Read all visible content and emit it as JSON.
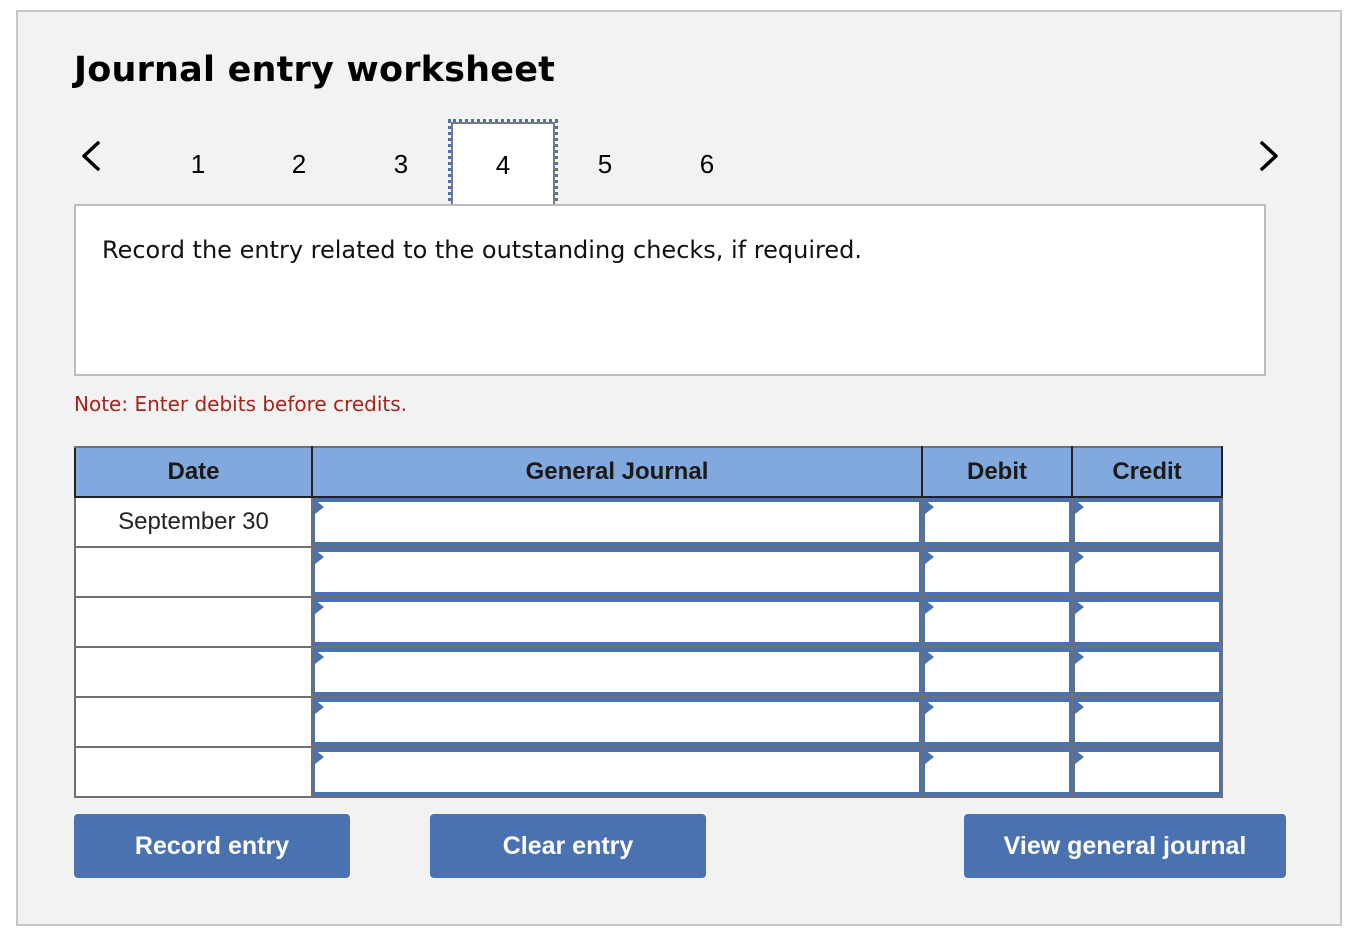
{
  "header": {
    "title": "Journal entry worksheet"
  },
  "stepper": {
    "prev_icon": "chevron-left-icon",
    "next_icon": "chevron-right-icon",
    "steps": [
      "1",
      "2",
      "3",
      "4",
      "5",
      "6"
    ],
    "active_step": "4"
  },
  "prompt": {
    "text": "Record the entry related to the outstanding checks, if required."
  },
  "note": {
    "text": "Note: Enter debits before credits.",
    "color": "#a6231c"
  },
  "journal_table": {
    "columns": [
      "Date",
      "General Journal",
      "Debit",
      "Credit"
    ],
    "rows": [
      {
        "date": "September 30",
        "account": "",
        "debit": "",
        "credit": ""
      },
      {
        "date": "",
        "account": "",
        "debit": "",
        "credit": ""
      },
      {
        "date": "",
        "account": "",
        "debit": "",
        "credit": ""
      },
      {
        "date": "",
        "account": "",
        "debit": "",
        "credit": ""
      },
      {
        "date": "",
        "account": "",
        "debit": "",
        "credit": ""
      },
      {
        "date": "",
        "account": "",
        "debit": "",
        "credit": ""
      }
    ],
    "header_color": "#81a9de",
    "input_border_color": "#4a72b0"
  },
  "buttons": {
    "record_entry": "Record entry",
    "clear_entry": "Clear entry",
    "view_general_journal": "View general journal",
    "color": "#4a72b0"
  }
}
